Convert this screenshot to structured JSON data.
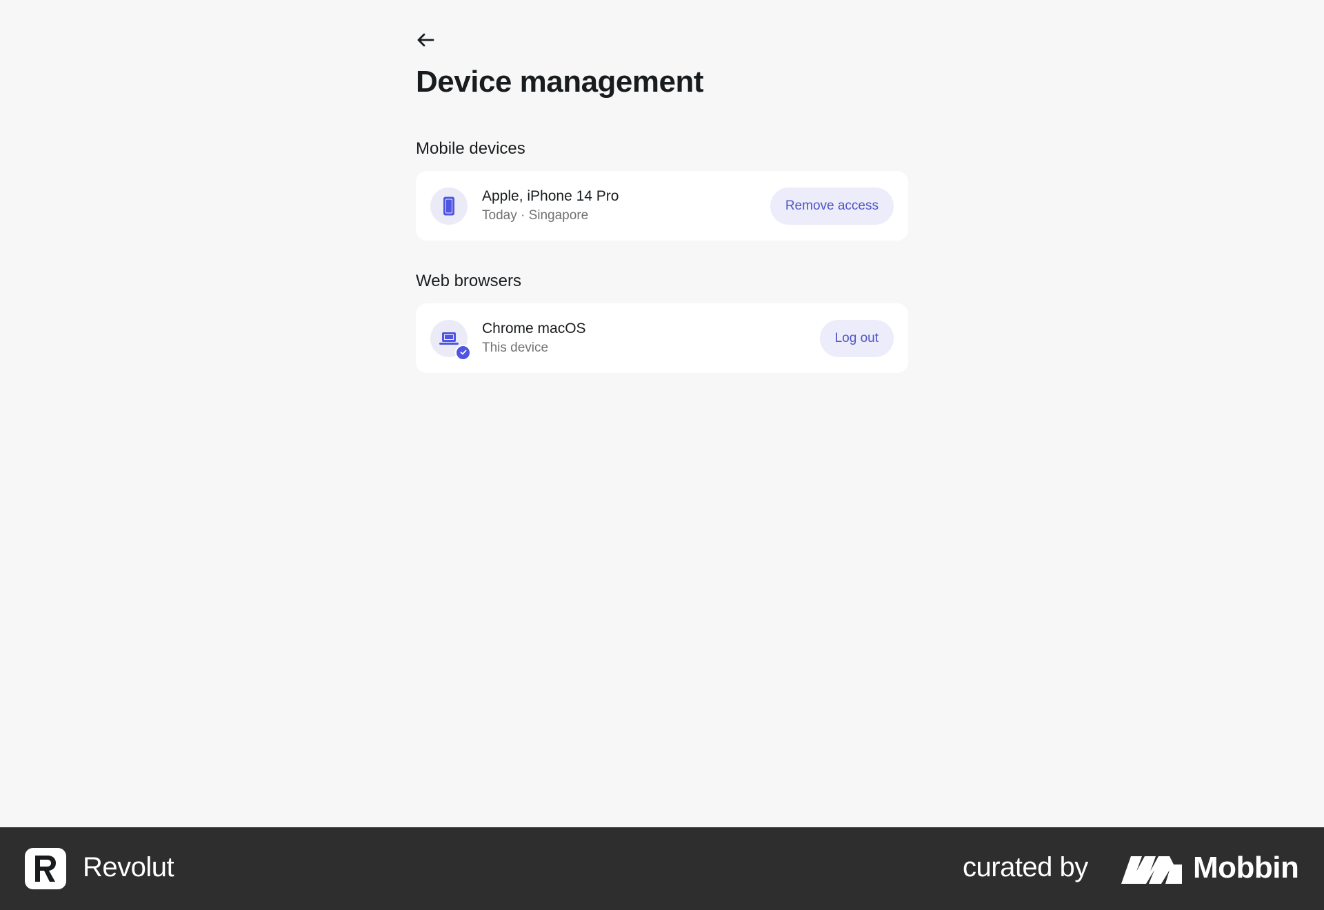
{
  "header": {
    "back_icon": "arrow-left-icon",
    "title": "Device management"
  },
  "sections": [
    {
      "title": "Mobile devices",
      "device": {
        "icon": "smartphone-icon",
        "name": "Apple, iPhone 14 Pro",
        "meta": "Today · Singapore",
        "action_label": "Remove access"
      }
    },
    {
      "title": "Web browsers",
      "device": {
        "icon": "laptop-icon",
        "badge_icon": "check-badge-icon",
        "name": "Chrome macOS",
        "meta": "This device",
        "action_label": "Log out"
      }
    }
  ],
  "footer": {
    "brand_name": "Revolut",
    "curated_by": "curated by",
    "curator_name": "Mobbin"
  },
  "colors": {
    "background": "#f7f7f7",
    "card": "#ffffff",
    "accent": "#4f55e0",
    "button_bg": "#ececfa",
    "button_text": "#4f55c4",
    "footer_bg": "#2e2e2e"
  }
}
